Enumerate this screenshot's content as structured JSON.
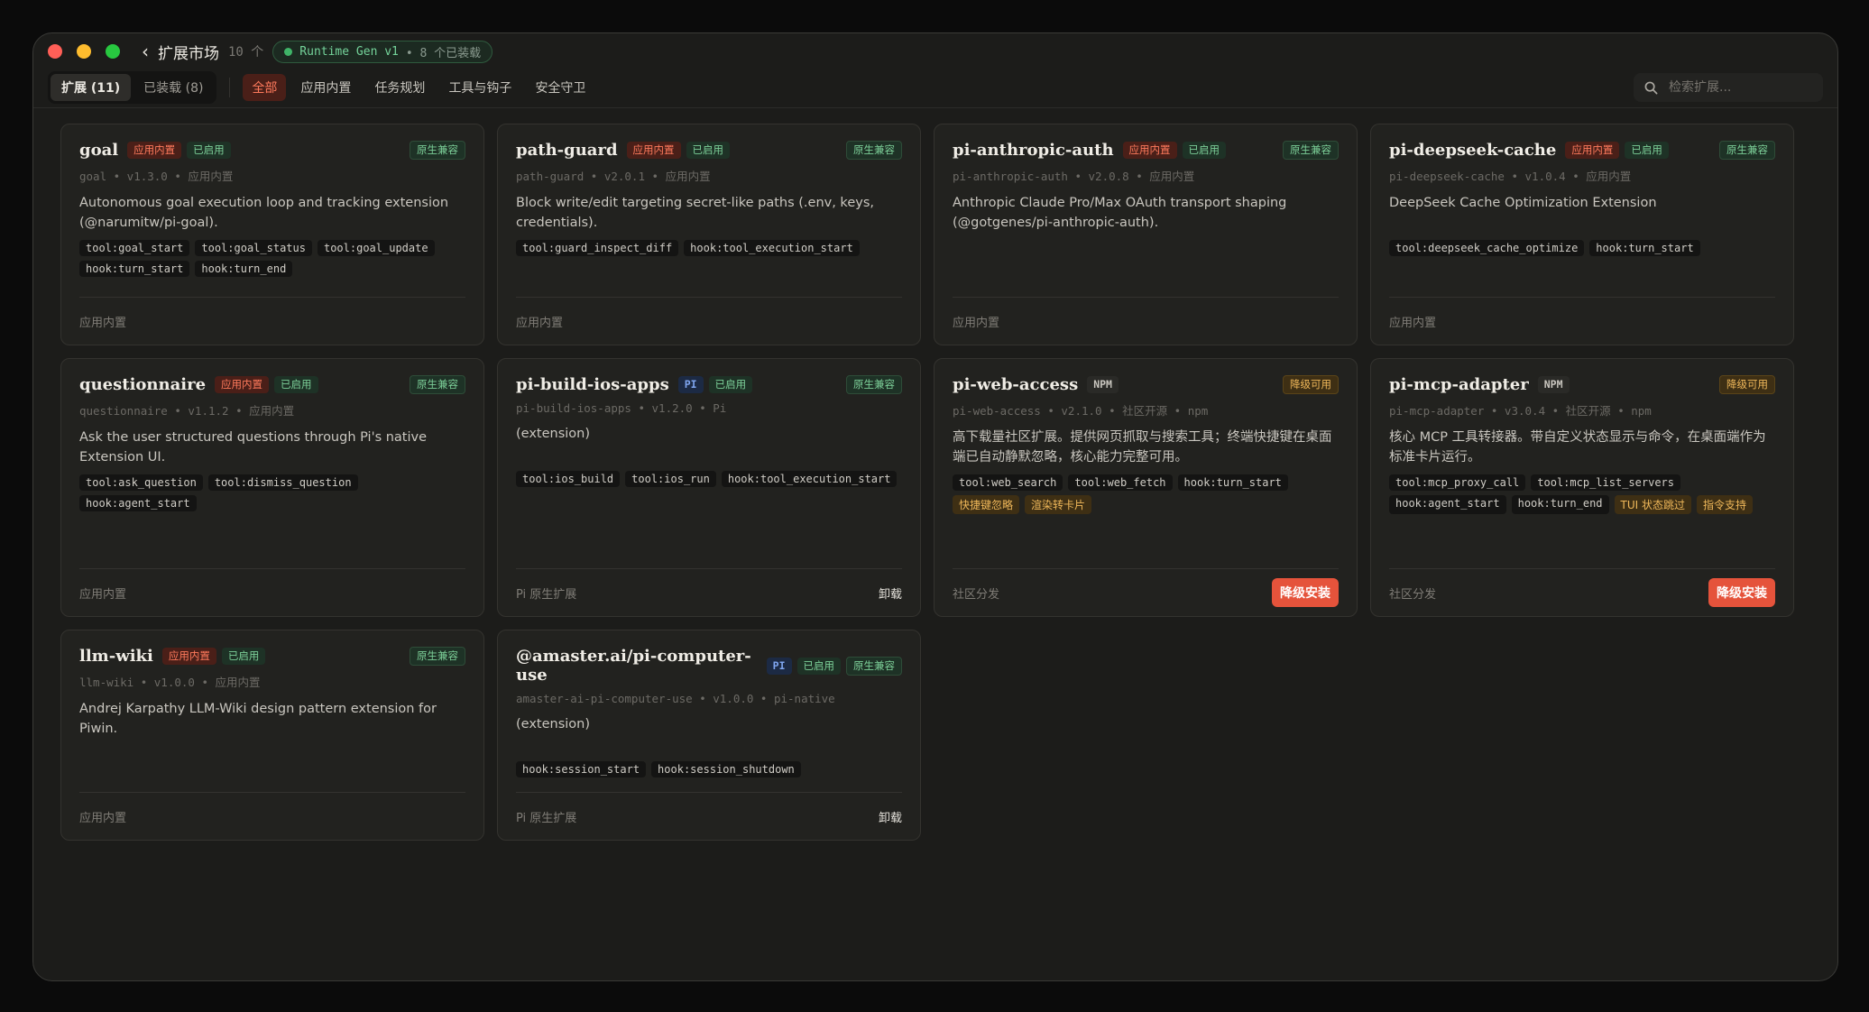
{
  "header": {
    "title": "扩展市场",
    "count": "10 个",
    "runtime": "Runtime Gen v1",
    "installed": "• 8 个已装载"
  },
  "tabs": [
    {
      "label": "扩展 (11)",
      "active": true
    },
    {
      "label": "已装载 (8)",
      "active": false
    }
  ],
  "filters": [
    {
      "label": "全部",
      "active": true
    },
    {
      "label": "应用内置",
      "active": false
    },
    {
      "label": "任务规划",
      "active": false
    },
    {
      "label": "工具与钩子",
      "active": false
    },
    {
      "label": "安全守卫",
      "active": false
    }
  ],
  "search": {
    "placeholder": "检索扩展..."
  },
  "cards": [
    {
      "name": "goal",
      "badges": [
        "应用内置",
        "已启用"
      ],
      "status": "原生兼容",
      "meta": "goal • v1.3.0 • 应用内置",
      "desc": "Autonomous goal execution loop and tracking extension (@narumitw/pi-goal).",
      "tags": [
        "tool:goal_start",
        "tool:goal_status",
        "tool:goal_update",
        "hook:turn_start",
        "hook:turn_end"
      ],
      "source": "应用内置",
      "action": ""
    },
    {
      "name": "path-guard",
      "badges": [
        "应用内置",
        "已启用"
      ],
      "status": "原生兼容",
      "meta": "path-guard • v2.0.1 • 应用内置",
      "desc": "Block write/edit targeting secret-like paths (.env, keys, credentials).",
      "tags": [
        "tool:guard_inspect_diff",
        "hook:tool_execution_start"
      ],
      "source": "应用内置",
      "action": ""
    },
    {
      "name": "pi-anthropic-auth",
      "badges": [
        "应用内置",
        "已启用"
      ],
      "status": "原生兼容",
      "meta": "pi-anthropic-auth • v2.0.8 • 应用内置",
      "desc": "Anthropic Claude Pro/Max OAuth transport shaping (@gotgenes/pi-anthropic-auth).",
      "tags": [],
      "source": "应用内置",
      "action": ""
    },
    {
      "name": "pi-deepseek-cache",
      "badges": [
        "应用内置",
        "已启用"
      ],
      "status": "原生兼容",
      "meta": "pi-deepseek-cache • v1.0.4 • 应用内置",
      "desc": "DeepSeek Cache Optimization Extension",
      "tags": [
        "tool:deepseek_cache_optimize",
        "hook:turn_start"
      ],
      "source": "应用内置",
      "action": ""
    },
    {
      "name": "questionnaire",
      "badges": [
        "应用内置",
        "已启用"
      ],
      "status": "原生兼容",
      "meta": "questionnaire • v1.1.2 • 应用内置",
      "desc": "Ask the user structured questions through Pi's native Extension UI.",
      "tags": [
        "tool:ask_question",
        "tool:dismiss_question",
        "hook:agent_start"
      ],
      "source": "应用内置",
      "action": ""
    },
    {
      "name": "pi-build-ios-apps",
      "badges": [
        "PI",
        "已启用"
      ],
      "status": "原生兼容",
      "meta": "pi-build-ios-apps • v1.2.0 • Pi",
      "desc": "(extension)",
      "tags": [
        "tool:ios_build",
        "tool:ios_run",
        "hook:tool_execution_start"
      ],
      "source": "Pi 原生扩展",
      "action": "卸载"
    },
    {
      "name": "pi-web-access",
      "badges": [
        "NPM"
      ],
      "status": "降级可用",
      "meta": "pi-web-access • v2.1.0 • 社区开源 • npm",
      "desc": "高下载量社区扩展。提供网页抓取与搜索工具；终端快捷键在桌面端已自动静默忽略，核心能力完整可用。",
      "tags": [
        "tool:web_search",
        "tool:web_fetch",
        "hook:turn_start"
      ],
      "warn_tags": [
        "快捷键忽略",
        "渲染转卡片"
      ],
      "source": "社区分发",
      "action": "降级安装"
    },
    {
      "name": "pi-mcp-adapter",
      "badges": [
        "NPM"
      ],
      "status": "降级可用",
      "meta": "pi-mcp-adapter • v3.0.4 • 社区开源 • npm",
      "desc": "核心 MCP 工具转接器。带自定义状态显示与命令，在桌面端作为标准卡片运行。",
      "tags": [
        "tool:mcp_proxy_call",
        "tool:mcp_list_servers",
        "hook:agent_start",
        "hook:turn_end"
      ],
      "warn_tags": [
        "TUI 状态跳过",
        "指令支持"
      ],
      "source": "社区分发",
      "action": "降级安装"
    },
    {
      "name": "llm-wiki",
      "badges": [
        "应用内置",
        "已启用"
      ],
      "status": "原生兼容",
      "meta": "llm-wiki • v1.0.0 • 应用内置",
      "desc": "Andrej Karpathy LLM-Wiki design pattern extension for Piwin.",
      "tags": [],
      "source": "应用内置",
      "action": ""
    },
    {
      "name": "@amaster.ai/pi-computer-use",
      "badges": [
        "PI",
        "已启用"
      ],
      "status": "原生兼容",
      "meta": "amaster-ai-pi-computer-use • v1.0.0 • pi-native",
      "desc": "(extension)",
      "tags": [
        "hook:session_start",
        "hook:session_shutdown"
      ],
      "source": "Pi 原生扩展",
      "action": "卸载"
    }
  ]
}
